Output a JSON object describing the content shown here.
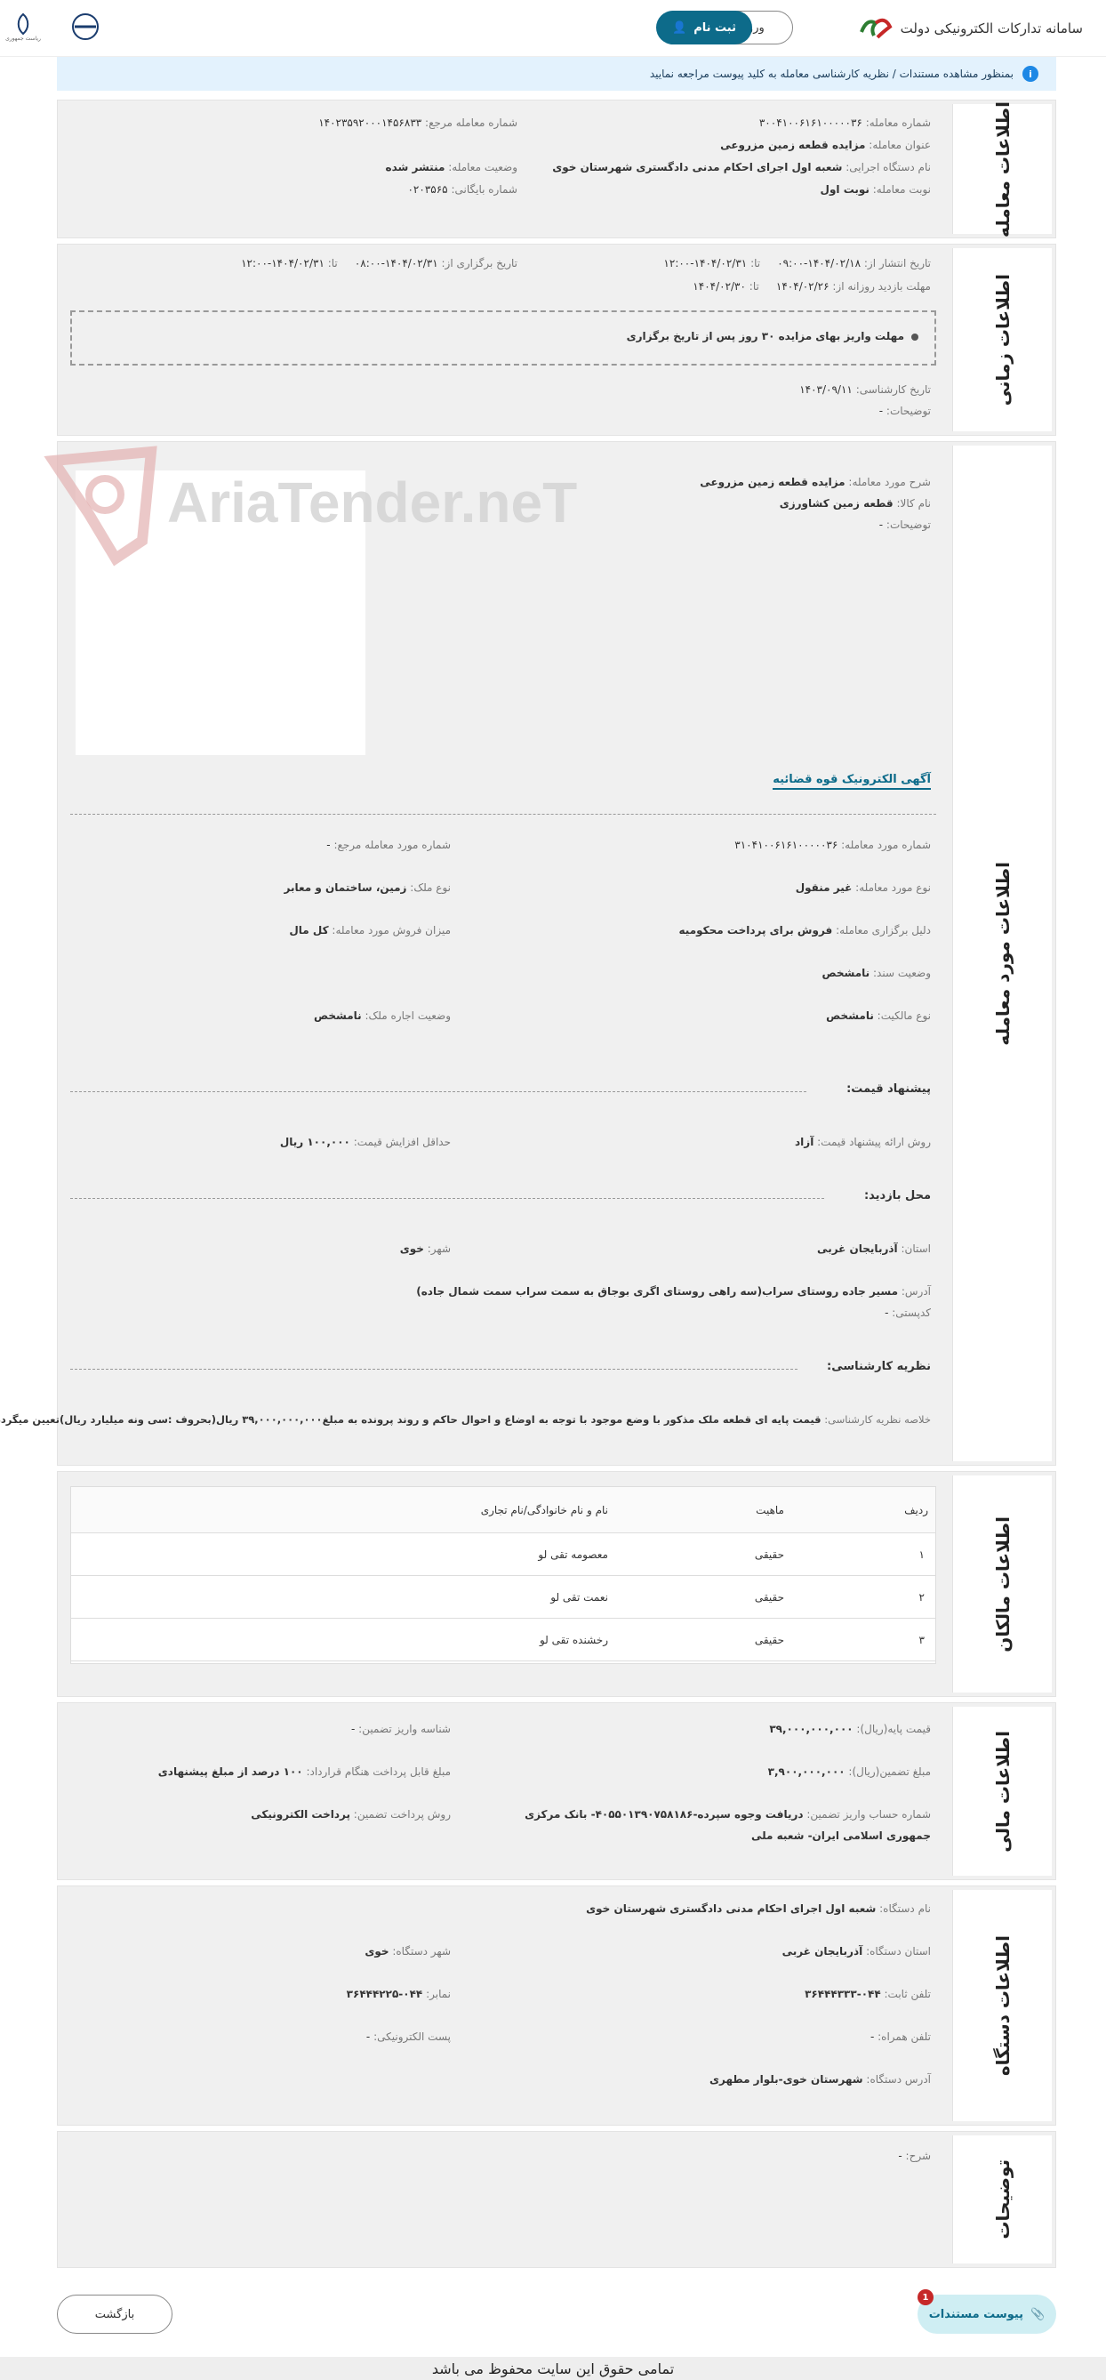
{
  "header": {
    "site_title": "سامانه تدارکات الکترونیکی دولت",
    "login_label": "ورود",
    "register_label": "ثبت نام",
    "gov_logo_1_text": "ریاست جمهوری",
    "gov_logo_2_text": ""
  },
  "notice": {
    "text": "بمنظور مشاهده مستندات / نظریه کارشناسی معامله به کلید پیوست مراجعه نمایید"
  },
  "transaction_info": {
    "title": "اطلاعات معامله",
    "number_label": "شماره معامله:",
    "number_value": "۳۰۰۴۱۰۰۶۱۶۱۰۰۰۰۰۳۶",
    "ref_label": "شماره معامله مرجع:",
    "ref_value": "۱۴۰۲۳۵۹۲۰۰۰۱۴۵۶۸۳۳",
    "subject_label": "عنوان معامله:",
    "subject_value": "مزایده قطعه زمین مزروعی",
    "agency_label": "نام دستگاه اجرایی:",
    "agency_value": "شعبه اول اجرای احکام مدنی دادگستری شهرستان خوی",
    "status_label": "وضعیت معامله:",
    "status_value": "منتشر شده",
    "round_label": "نوبت معامله:",
    "round_value": "نوبت اول",
    "archive_label": "شماره بایگانی:",
    "archive_value": "۰۲۰۳۵۶۵"
  },
  "time_info": {
    "title": "اطلاعات زمانی",
    "publish_from_label": "تاریخ انتشار از:",
    "publish_from_value": "۱۴۰۴/۰۲/۱۸-۰۹:۰۰",
    "publish_to_label": "تا:",
    "publish_to_value": "۱۴۰۴/۰۲/۳۱-۱۲:۰۰",
    "hold_from_label": "تاریخ برگزاری از:",
    "hold_from_value": "۱۴۰۴/۰۲/۳۱-۰۸:۰۰",
    "hold_to_label": "تا:",
    "hold_to_value": "۱۴۰۴/۰۲/۳۱-۱۲:۰۰",
    "visit_from_label": "مهلت بازدید روزانه از:",
    "visit_from_value": "۱۴۰۴/۰۲/۲۶",
    "visit_to_label": "تا:",
    "visit_to_value": "۱۴۰۴/۰۲/۳۰",
    "deadline_text": "مهلت واریز بهای مزایده ۳۰ روز پس از تاریخ برگزاری",
    "expert_date_label": "تاریخ کارشناسی:",
    "expert_date_value": "۱۴۰۳/۰۹/۱۱",
    "desc_label": "توضیحات:",
    "desc_value": "-"
  },
  "item_info": {
    "title": "اطلاعات مورد معامله",
    "desc_label": "شرح مورد معامله:",
    "desc_value": "مزایده قطعه زمین مزروعی",
    "goods_label": "نام کالا:",
    "goods_value": "قطعه زمین کشاورزی",
    "notes_label": "توضیحات:",
    "notes_value": "-",
    "watermark": "AriaTender.neT",
    "ad_link": "آگهی الکترونیک قوه قضائیه",
    "item_no_label": "شماره مورد معامله:",
    "item_no_value": "۳۱۰۴۱۰۰۶۱۶۱۰۰۰۰۰۳۶",
    "item_ref_label": "شماره مورد معامله مرجع:",
    "item_ref_value": "-",
    "item_type_label": "نوع مورد معامله:",
    "item_type_value": "غیر منقول",
    "property_type_label": "نوع ملک:",
    "property_type_value": "زمین، ساختمان و معابر",
    "reason_label": "دلیل برگزاری معامله:",
    "reason_value": "فروش برای پرداخت محکومیه",
    "sale_amount_label": "میزان فروش مورد معامله:",
    "sale_amount_value": "کل مال",
    "doc_status_label": "وضعیت سند:",
    "doc_status_value": "نامشخص",
    "ownership_label": "نوع مالکیت:",
    "ownership_value": "نامشخص",
    "lease_label": "وضعیت اجاره ملک:",
    "lease_value": "نامشخص",
    "price_heading": "پیشنهاد قیمت:",
    "price_method_label": "روش ارائه پیشنهاد قیمت:",
    "price_method_value": "آزاد",
    "min_increase_label": "حداقل افزایش قیمت:",
    "min_increase_value": "۱۰۰,۰۰۰ ریال",
    "visit_heading": "محل بازدید:",
    "province_label": "استان:",
    "province_value": "آذربایجان غربی",
    "city_label": "شهر:",
    "city_value": "خوی",
    "address_label": "آدرس:",
    "address_value": "مسیر جاده روستای سراب(سه راهی روستای اگری بوجاق به سمت سراب سمت شمال جاده)",
    "postal_label": "کدپستی:",
    "postal_value": "-",
    "expert_heading": "نظریه کارشناسی:",
    "expert_summary_label": "خلاصه نظریه کارشناسی:",
    "expert_summary_value": "قیمت پایه ای قطعه ملک مذکور با وضع موجود با توجه به اوضاع و احوال حاکم و روند پرونده به مبلغ۳۹,۰۰۰,۰۰۰,۰۰۰ ریال(بحروف :سی ونه میلیارد ریال)تعیین میگردد."
  },
  "owners": {
    "title": "اطلاعات مالکان",
    "headers": [
      "ردیف",
      "ماهیت",
      "نام و نام خانوادگی/نام تجاری"
    ],
    "rows": [
      {
        "idx": "۱",
        "type": "حقیقی",
        "name": "معصومه تقی لو"
      },
      {
        "idx": "۲",
        "type": "حقیقی",
        "name": "نعمت تقی لو"
      },
      {
        "idx": "۳",
        "type": "حقیقی",
        "name": "رخشنده تقی لو"
      }
    ]
  },
  "financial": {
    "title": "اطلاعات مالی",
    "base_price_label": "قیمت پایه(ریال):",
    "base_price_value": "۳۹,۰۰۰,۰۰۰,۰۰۰",
    "deposit_id_label": "شناسه واریز تضمین:",
    "deposit_id_value": "-",
    "guarantee_label": "مبلغ تضمین(ریال):",
    "guarantee_value": "۳,۹۰۰,۰۰۰,۰۰۰",
    "contract_pay_label": "مبلغ قابل پرداخت هنگام قرارداد:",
    "contract_pay_value": "۱۰۰ درصد از مبلغ پیشنهادی",
    "account_label": "شماره حساب واریز تضمین:",
    "account_value_1": "دریافت وجوه سپرده-۴۰۵۵۰۱۳۹۰۷۵۸۱۸۶- بانک مرکزی",
    "account_value_2": "جمهوری اسلامی ایران- شعبه ملی",
    "pay_method_label": "روش پرداخت تضمین:",
    "pay_method_value": "پرداخت الکترونیکی"
  },
  "agency": {
    "title": "اطلاعات دستگاه",
    "name_label": "نام دستگاه:",
    "name_value": "شعبه اول اجرای احکام مدنی دادگستری شهرستان خوی",
    "province_label": "استان دستگاه:",
    "province_value": "آذربایجان غربی",
    "city_label": "شهر دستگاه:",
    "city_value": "خوی",
    "phone_label": "تلفن ثابت:",
    "phone_value": "۰۴۴-۳۶۴۴۴۳۳۳",
    "fax_label": "نمابر:",
    "fax_value": "۰۴۴-۳۶۴۴۴۲۲۵",
    "mobile_label": "تلفن همراه:",
    "mobile_value": "-",
    "email_label": "پست الکترونیکی:",
    "email_value": "-",
    "address_label": "آدرس دستگاه:",
    "address_value": "شهرستان خوی-بلوار مطهری"
  },
  "explanations": {
    "title": "توضیحات",
    "desc_label": "شرح:",
    "desc_value": "-"
  },
  "actions": {
    "attach_label": "پیوست مستندات",
    "attach_badge": "1",
    "back_label": "بازگشت"
  },
  "footer": {
    "text": "تمامی حقوق این سایت محفوظ می باشد"
  }
}
